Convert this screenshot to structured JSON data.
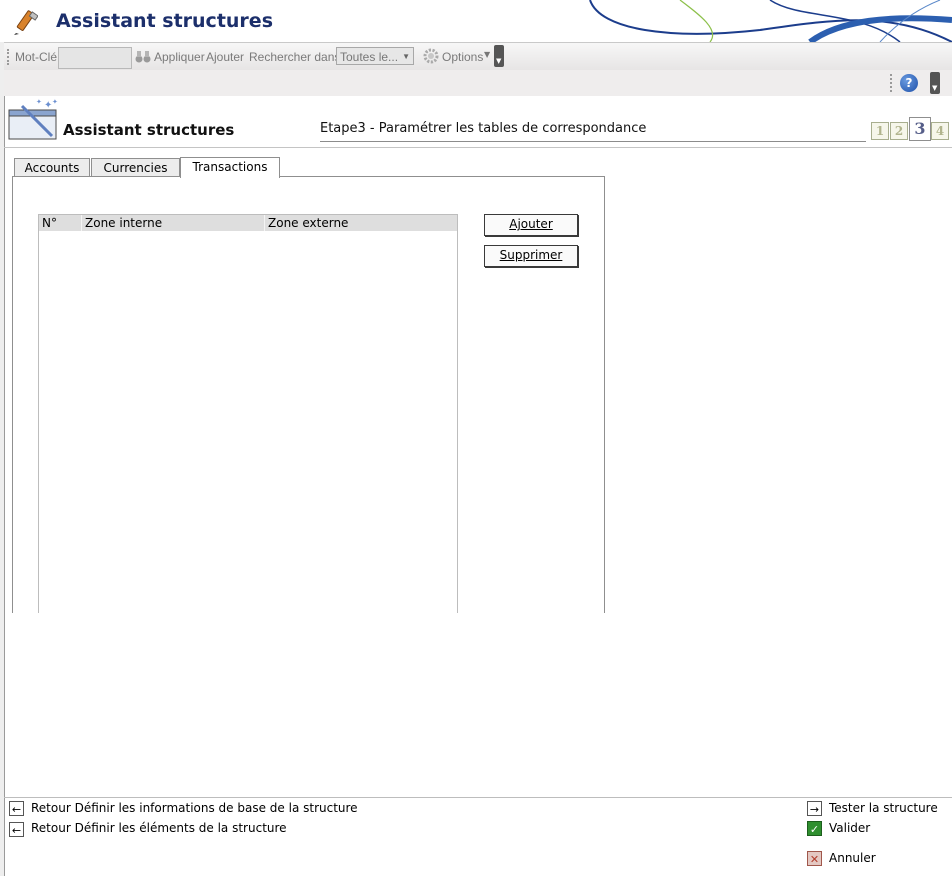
{
  "app": {
    "title": "Assistant structures"
  },
  "toolbar": {
    "mot_cle_label": "Mot-Clé",
    "mot_cle_value": "",
    "appliquer_label": "Appliquer",
    "ajouter_label": "Ajouter",
    "rechercher_label": "Rechercher dans",
    "rechercher_value": "Toutes le...",
    "options_label": "Options"
  },
  "help": {
    "label": "?"
  },
  "wizard": {
    "title": "Assistant structures",
    "step_title": "Etape3 - Paramétrer les tables de correspondance",
    "steps": [
      "1",
      "2",
      "3",
      "4"
    ],
    "current_step": 3
  },
  "tabs": [
    {
      "label": "Accounts",
      "active": false
    },
    {
      "label": "Currencies",
      "active": false
    },
    {
      "label": "Transactions",
      "active": true
    }
  ],
  "grid": {
    "columns": [
      "N°",
      "Zone interne",
      "Zone externe"
    ],
    "rows": []
  },
  "actions": {
    "ajouter": "Ajouter",
    "supprimer": "Supprimer"
  },
  "footer": {
    "back_links": [
      "Retour Définir les informations de base de la structure",
      "Retour Définir les éléments de la structure"
    ],
    "tester": "Tester la structure",
    "valider": "Valider",
    "annuler": "Annuler"
  },
  "colors": {
    "title_blue": "#1c2f6b",
    "accent_blue": "#1d4fa8",
    "valider_green": "#2f8f2f",
    "annuler_red": "#b23b2a"
  }
}
